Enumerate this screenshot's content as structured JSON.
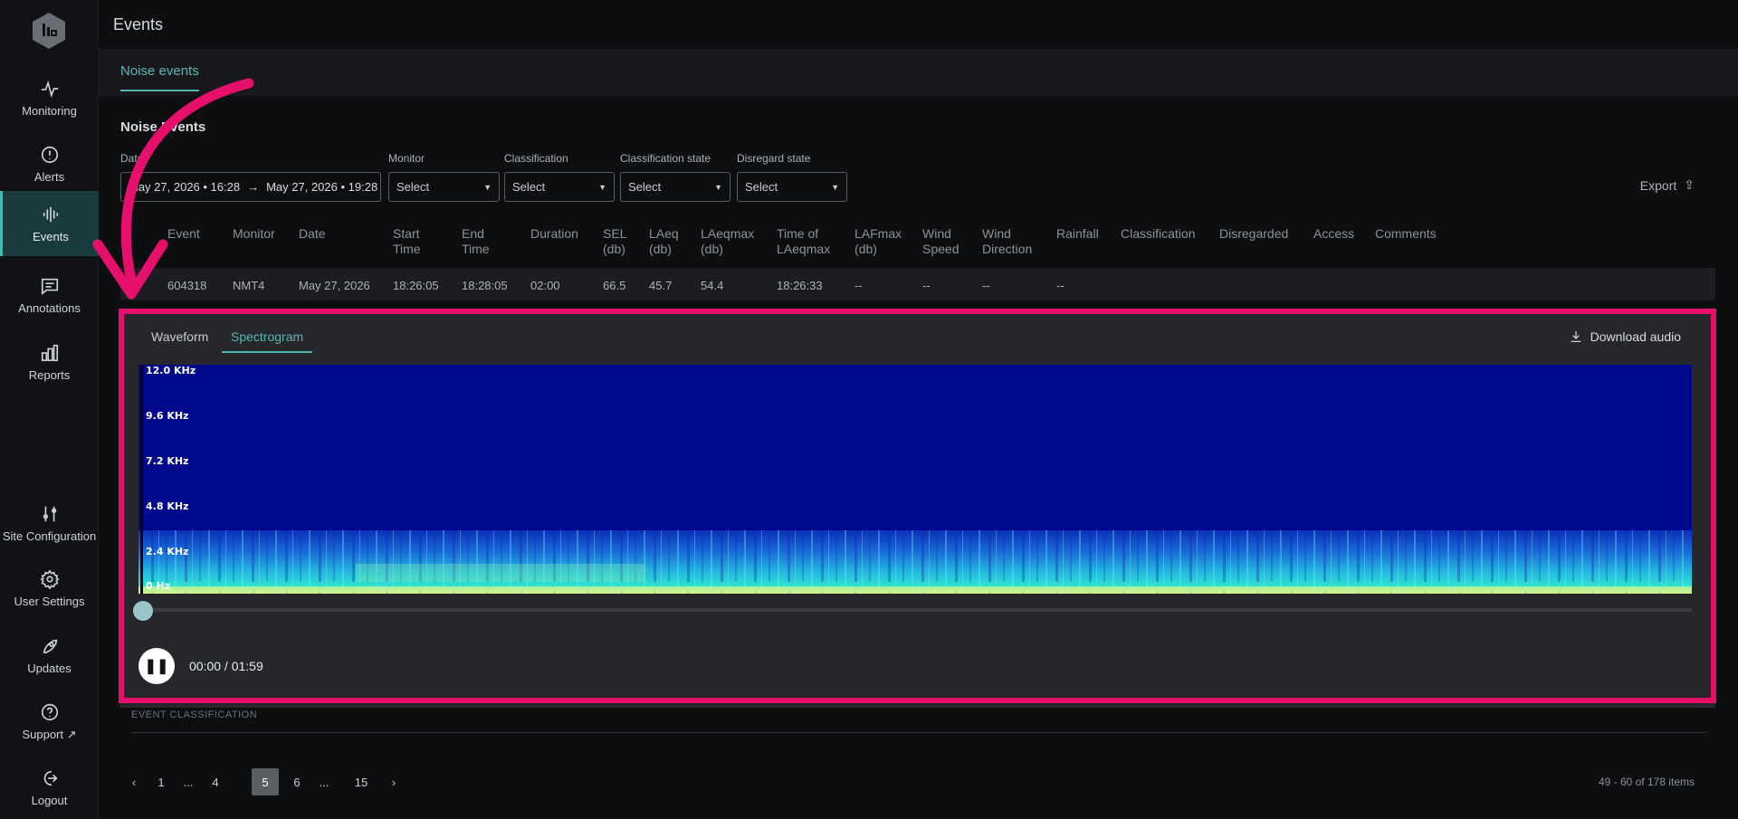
{
  "sidebar": {
    "items": [
      {
        "label": "Monitoring",
        "icon": "activity-icon"
      },
      {
        "label": "Alerts",
        "icon": "alert-circle-icon"
      },
      {
        "label": "Events",
        "icon": "audio-wave-icon"
      },
      {
        "label": "Annotations",
        "icon": "message-square-icon"
      },
      {
        "label": "Reports",
        "icon": "bar-chart-icon"
      }
    ],
    "bottom_items": [
      {
        "label": "Site Configuration",
        "icon": "sliders-icon"
      },
      {
        "label": "User Settings",
        "icon": "gear-icon"
      },
      {
        "label": "Updates",
        "icon": "rocket-icon"
      },
      {
        "label": "Support",
        "icon": "help-circle-icon"
      },
      {
        "label": "Logout",
        "icon": "logout-icon"
      }
    ]
  },
  "header": {
    "title": "Events"
  },
  "tabs": [
    {
      "label": "Noise events"
    }
  ],
  "section_title": "Noise Events",
  "filters": {
    "date_label": "Date",
    "date_from": "May 27, 2026 • 16:28",
    "date_to": "May 27, 2026 • 19:28",
    "monitor_label": "Monitor",
    "monitor_value": "Select",
    "classification_label": "Classification",
    "classification_value": "Select",
    "classification_state_label": "Classification state",
    "classification_state_value": "Select",
    "disregard_state_label": "Disregard state",
    "disregard_state_value": "Select"
  },
  "export_label": "Export",
  "table": {
    "columns": [
      "Event",
      "Monitor",
      "Date",
      "Start Time",
      "End Time",
      "Duration",
      "SEL (db)",
      "LAeq (db)",
      "LAeqmax (db)",
      "Time of LAeqmax",
      "LAFmax (db)",
      "Wind Speed",
      "Wind Direction",
      "Rainfall",
      "Classification",
      "Disregarded",
      "Access",
      "Comments"
    ],
    "row": [
      "604318",
      "NMT4",
      "May 27, 2026",
      "18:26:05",
      "18:28:05",
      "02:00",
      "66.5",
      "45.7",
      "54.4",
      "18:26:33",
      "--",
      "--",
      "--",
      "--"
    ]
  },
  "player": {
    "tabs": [
      "Waveform",
      "Spectrogram"
    ],
    "active_tab": "Spectrogram",
    "download_label": "Download audio",
    "freq_labels": [
      "12.0 KHz",
      "9.6 KHz",
      "7.2 KHz",
      "4.8 KHz",
      "2.4 KHz",
      "0 Hz"
    ],
    "time": "00:00 / 01:59",
    "progress": 0
  },
  "event_classification_label": "EVENT CLASSIFICATION",
  "pagination": {
    "pages": [
      "1",
      "...",
      "4",
      "5",
      "6",
      "...",
      "15"
    ],
    "active": "5",
    "items_text": "49 - 60 of 178 items"
  },
  "colors": {
    "accent": "#4fb5b3",
    "highlight": "#e6106c",
    "spectrogram_bg": "#00088c"
  }
}
